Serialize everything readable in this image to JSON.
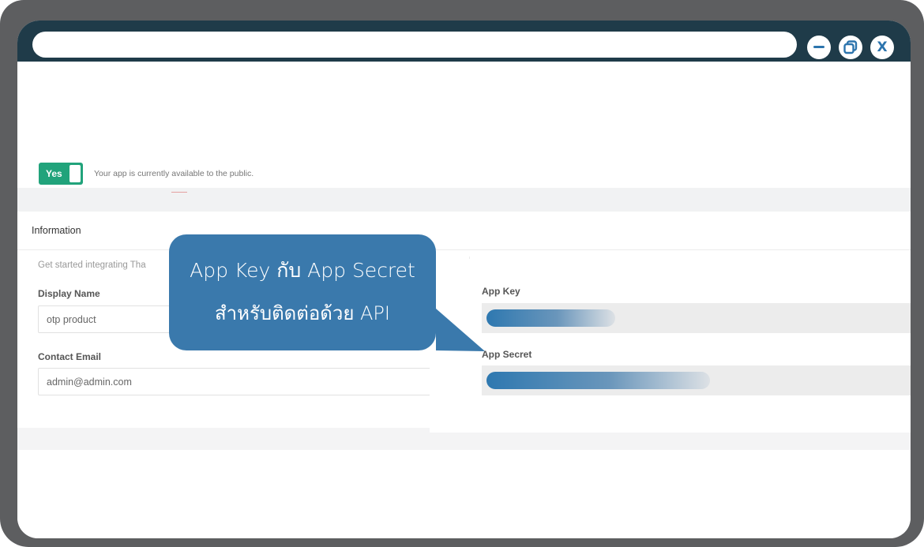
{
  "window": {
    "url": "",
    "controls": {
      "minimize_icon": "minus-icon",
      "maximize_icon": "restore-icon",
      "close_label": "X"
    }
  },
  "publish": {
    "toggle_label": "Yes",
    "status_text": "Your app is currently available to the public."
  },
  "information": {
    "title": "Information",
    "intro": "Get started integrating Tha",
    "display_name": {
      "label": "Display Name",
      "value": "otp product"
    },
    "contact_email": {
      "label": "Contact Email",
      "value": "admin@admin.com"
    }
  },
  "credentials": {
    "app_key_label": "App Key",
    "app_secret_label": "App Secret"
  },
  "callout": {
    "line1": "App Key กับ App Secret",
    "line2": "สำหรับติดต่อด้วย API"
  },
  "colors": {
    "frame": "#5d5e60",
    "titlebar": "#1f3b49",
    "accent": "#2c74ad",
    "toggle": "#21a37b",
    "callout": "#3a79ac"
  }
}
